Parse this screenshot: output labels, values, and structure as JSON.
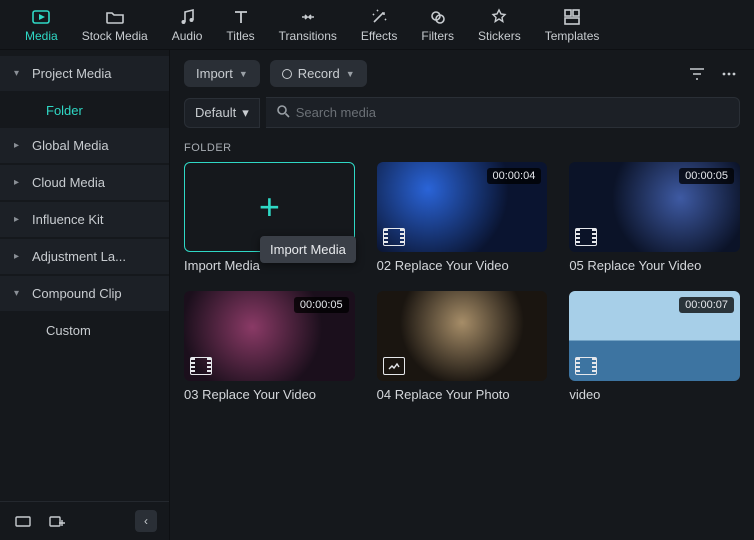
{
  "tabs": [
    {
      "label": "Media",
      "icon": "media"
    },
    {
      "label": "Stock Media",
      "icon": "stock"
    },
    {
      "label": "Audio",
      "icon": "audio"
    },
    {
      "label": "Titles",
      "icon": "titles"
    },
    {
      "label": "Transitions",
      "icon": "transitions"
    },
    {
      "label": "Effects",
      "icon": "effects"
    },
    {
      "label": "Filters",
      "icon": "filters"
    },
    {
      "label": "Stickers",
      "icon": "stickers"
    },
    {
      "label": "Templates",
      "icon": "templates"
    }
  ],
  "sidebar": {
    "items": [
      {
        "label": "Project Media",
        "expanded": true,
        "children": [
          {
            "label": "Folder",
            "active": true
          }
        ]
      },
      {
        "label": "Global Media",
        "expanded": false
      },
      {
        "label": "Cloud Media",
        "expanded": false
      },
      {
        "label": "Influence Kit",
        "expanded": false
      },
      {
        "label": "Adjustment La...",
        "expanded": false
      },
      {
        "label": "Compound Clip",
        "expanded": true,
        "children": [
          {
            "label": "Custom",
            "active": false
          }
        ]
      }
    ]
  },
  "toolbar": {
    "import_label": "Import",
    "record_label": "Record"
  },
  "search": {
    "sort_label": "Default",
    "placeholder": "Search media"
  },
  "section_label": "FOLDER",
  "tooltip": "Import Media",
  "cards": [
    {
      "title": "Import Media",
      "type": "import"
    },
    {
      "title": "02 Replace Your Video",
      "type": "video",
      "duration": "00:00:04",
      "bg": "bg-concert"
    },
    {
      "title": "05 Replace Your Video",
      "type": "video",
      "duration": "00:00:05",
      "bg": "bg-singer"
    },
    {
      "title": "03 Replace Your Video",
      "type": "video",
      "duration": "00:00:05",
      "bg": "bg-party"
    },
    {
      "title": "04 Replace Your Photo",
      "type": "photo",
      "bg": "bg-photo"
    },
    {
      "title": "video",
      "type": "video",
      "duration": "00:00:07",
      "bg": "bg-sea"
    }
  ]
}
